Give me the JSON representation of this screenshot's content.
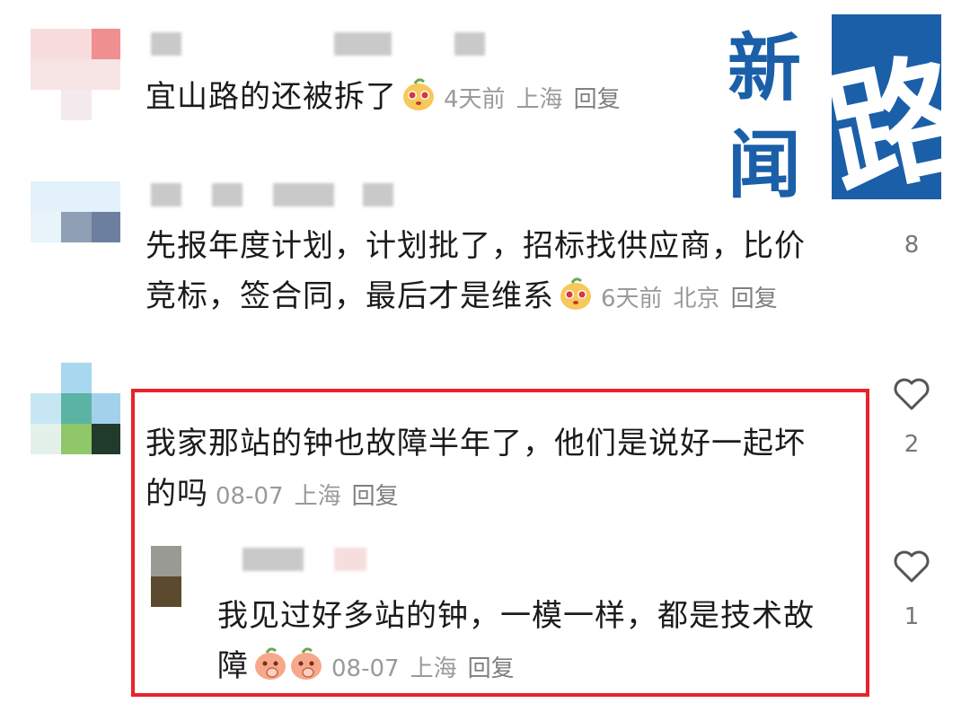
{
  "comments": [
    {
      "text": "宜山路的还被拆了",
      "emoji": "peach-face-emoji",
      "time": "4天前",
      "location": "上海",
      "reply_label": "回复",
      "likes": ""
    },
    {
      "text_line1": "先报年度计划，计划批了，招标找供应商，比价",
      "text_line2": "竞标，签合同，最后才是维系",
      "emoji": "peach-face-emoji",
      "time": "6天前",
      "location": "北京",
      "reply_label": "回复",
      "likes": "8"
    },
    {
      "text_line1": "我家那站的钟也故障半年了，他们是说好一起坏",
      "text_line2": "的吗",
      "time": "08-07",
      "location": "上海",
      "reply_label": "回复",
      "likes": "2"
    }
  ],
  "reply": {
    "text_line1": "我见过好多站的钟，一模一样，都是技术故",
    "text_line2": "障",
    "emoji": "thinking-peach-emoji",
    "time": "08-07",
    "location": "上海",
    "reply_label": "回复",
    "likes": "1"
  },
  "logo": {
    "chars": [
      "新",
      "闻",
      "路"
    ],
    "color": "#1a5fa8"
  },
  "colors": {
    "highlight_border": "#e8232c",
    "meta_text": "#9a9a9a"
  }
}
